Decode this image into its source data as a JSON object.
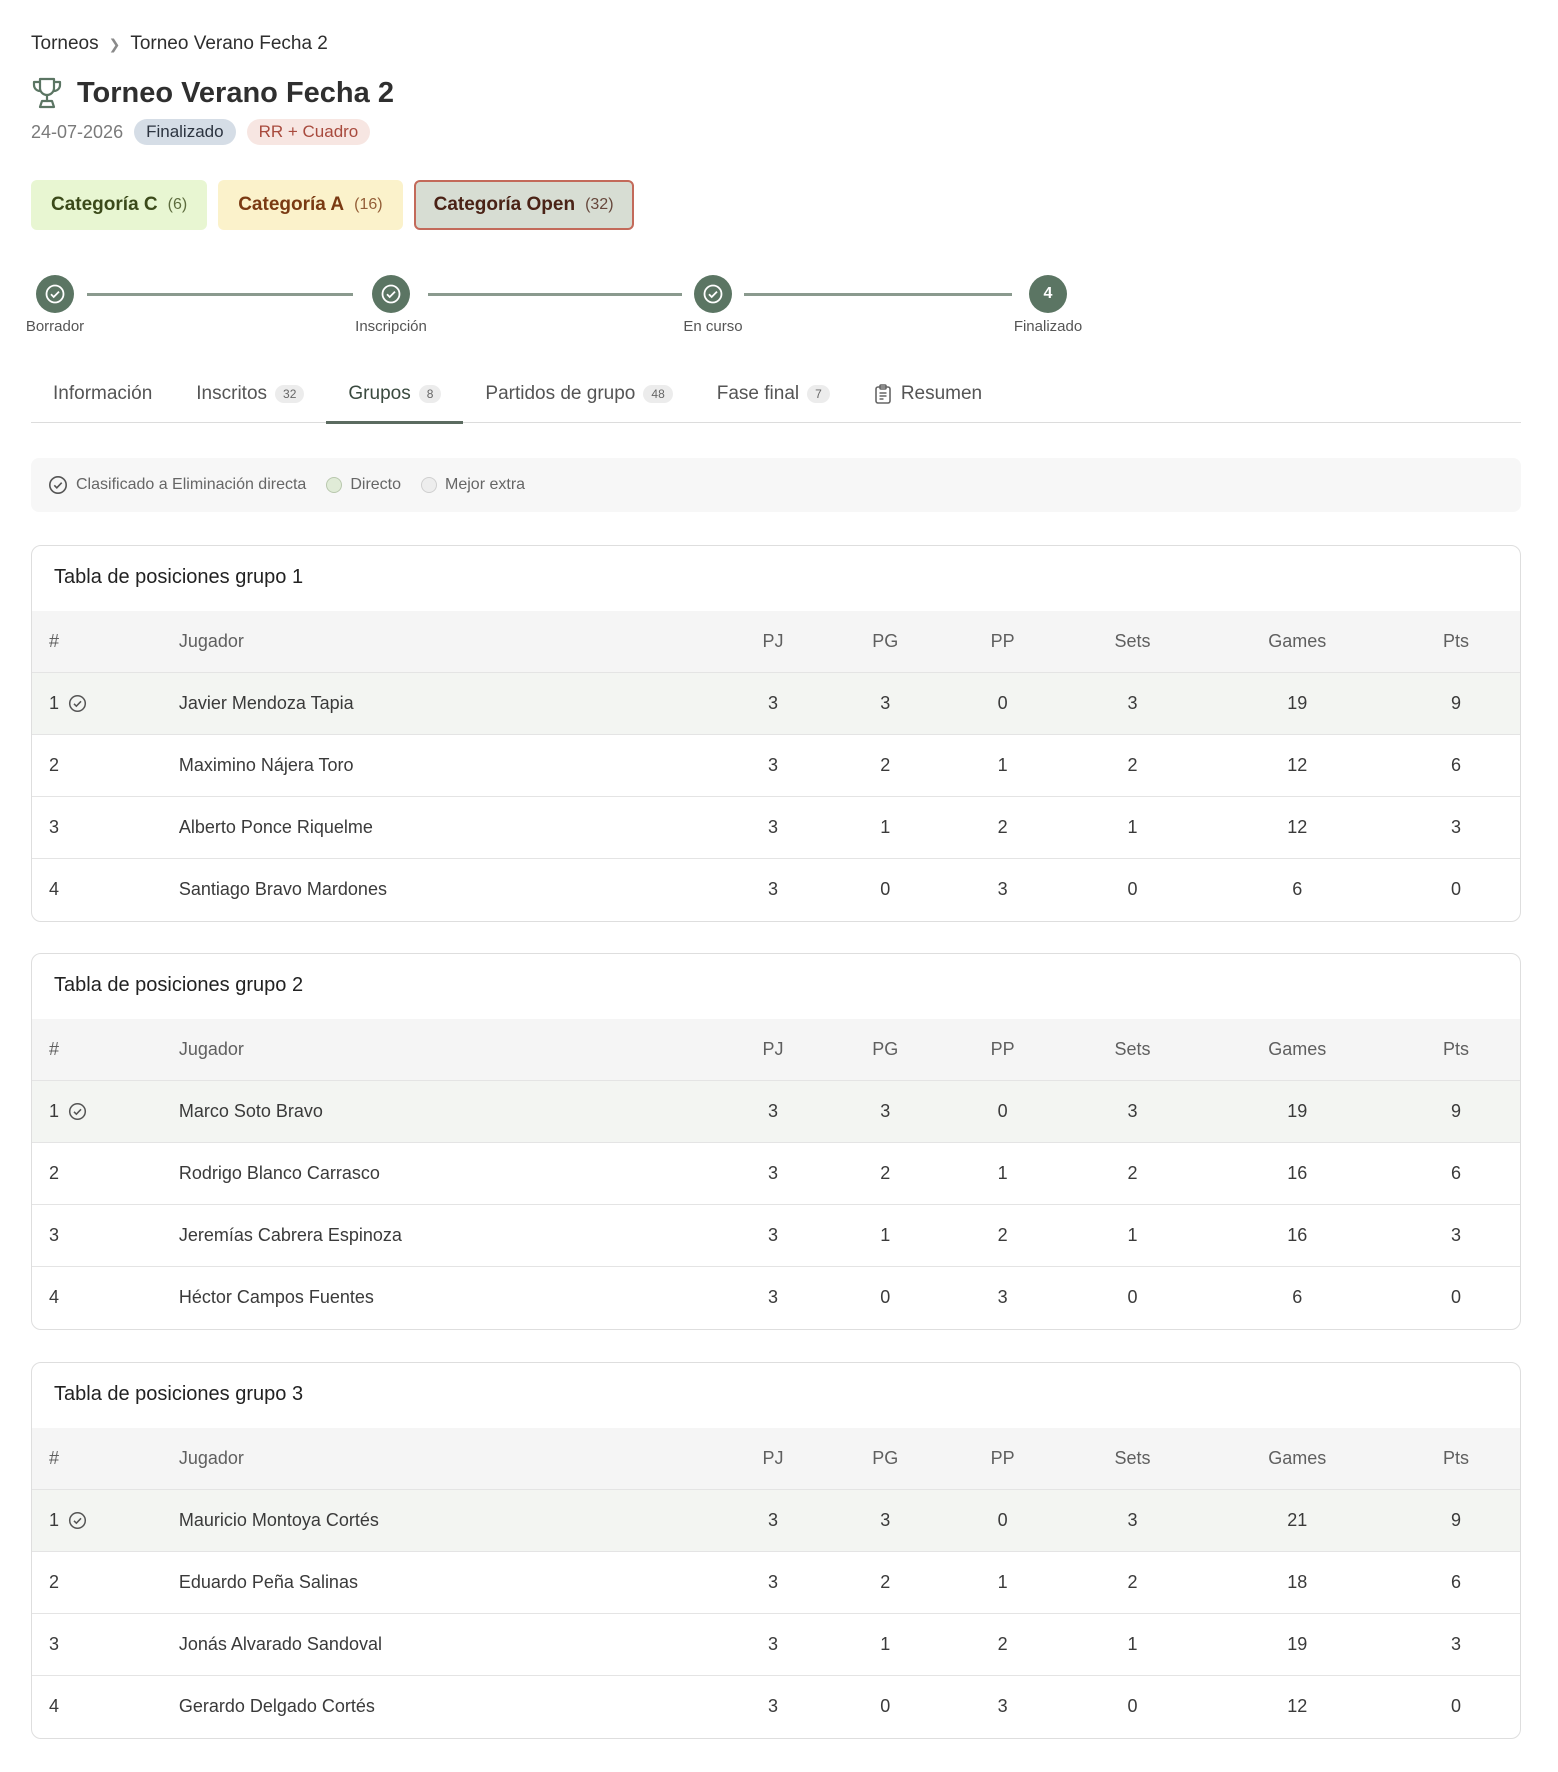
{
  "breadcrumb": {
    "parent": "Torneos",
    "current": "Torneo Verano Fecha 2"
  },
  "tournament": {
    "title": "Torneo Verano Fecha 2",
    "date": "24-07-2026",
    "status": "Finalizado",
    "format": "RR + Cuadro"
  },
  "categories": [
    {
      "label": "Categoría C",
      "count": "(6)"
    },
    {
      "label": "Categoría A",
      "count": "(16)"
    },
    {
      "label": "Categoría Open",
      "count": "(32)"
    }
  ],
  "stepper": [
    {
      "label": "Borrador",
      "marker": "check"
    },
    {
      "label": "Inscripción",
      "marker": "check"
    },
    {
      "label": "En curso",
      "marker": "check"
    },
    {
      "label": "Finalizado",
      "marker": "4"
    }
  ],
  "tabs": [
    {
      "label": "Información",
      "count": ""
    },
    {
      "label": "Inscritos",
      "count": "32"
    },
    {
      "label": "Grupos",
      "count": "8"
    },
    {
      "label": "Partidos de grupo",
      "count": "48"
    },
    {
      "label": "Fase final",
      "count": "7"
    },
    {
      "label": "Resumen",
      "count": ""
    }
  ],
  "legend": {
    "qualified": "Clasificado a Eliminación directa",
    "direct": "Directo",
    "best_extra": "Mejor extra"
  },
  "table_headers": {
    "pos": "#",
    "player": "Jugador",
    "pj": "PJ",
    "pg": "PG",
    "pp": "PP",
    "sets": "Sets",
    "games": "Games",
    "pts": "Pts"
  },
  "groups": [
    {
      "title": "Tabla de posiciones grupo 1",
      "rows": [
        {
          "pos": "1",
          "qualified": true,
          "player": "Javier Mendoza Tapia",
          "pj": "3",
          "pg": "3",
          "pp": "0",
          "sets": "3",
          "games": "19",
          "pts": "9"
        },
        {
          "pos": "2",
          "qualified": false,
          "player": "Maximino Nájera Toro",
          "pj": "3",
          "pg": "2",
          "pp": "1",
          "sets": "2",
          "games": "12",
          "pts": "6"
        },
        {
          "pos": "3",
          "qualified": false,
          "player": "Alberto Ponce Riquelme",
          "pj": "3",
          "pg": "1",
          "pp": "2",
          "sets": "1",
          "games": "12",
          "pts": "3"
        },
        {
          "pos": "4",
          "qualified": false,
          "player": "Santiago Bravo Mardones",
          "pj": "3",
          "pg": "0",
          "pp": "3",
          "sets": "0",
          "games": "6",
          "pts": "0"
        }
      ]
    },
    {
      "title": "Tabla de posiciones grupo 2",
      "rows": [
        {
          "pos": "1",
          "qualified": true,
          "player": "Marco Soto Bravo",
          "pj": "3",
          "pg": "3",
          "pp": "0",
          "sets": "3",
          "games": "19",
          "pts": "9"
        },
        {
          "pos": "2",
          "qualified": false,
          "player": "Rodrigo Blanco Carrasco",
          "pj": "3",
          "pg": "2",
          "pp": "1",
          "sets": "2",
          "games": "16",
          "pts": "6"
        },
        {
          "pos": "3",
          "qualified": false,
          "player": "Jeremías Cabrera Espinoza",
          "pj": "3",
          "pg": "1",
          "pp": "2",
          "sets": "1",
          "games": "16",
          "pts": "3"
        },
        {
          "pos": "4",
          "qualified": false,
          "player": "Héctor Campos Fuentes",
          "pj": "3",
          "pg": "0",
          "pp": "3",
          "sets": "0",
          "games": "6",
          "pts": "0"
        }
      ]
    },
    {
      "title": "Tabla de posiciones grupo 3",
      "rows": [
        {
          "pos": "1",
          "qualified": true,
          "player": "Mauricio Montoya Cortés",
          "pj": "3",
          "pg": "3",
          "pp": "0",
          "sets": "3",
          "games": "21",
          "pts": "9"
        },
        {
          "pos": "2",
          "qualified": false,
          "player": "Eduardo Peña Salinas",
          "pj": "3",
          "pg": "2",
          "pp": "1",
          "sets": "2",
          "games": "18",
          "pts": "6"
        },
        {
          "pos": "3",
          "qualified": false,
          "player": "Jonás Alvarado Sandoval",
          "pj": "3",
          "pg": "1",
          "pp": "2",
          "sets": "1",
          "games": "19",
          "pts": "3"
        },
        {
          "pos": "4",
          "qualified": false,
          "player": "Gerardo Delgado Cortés",
          "pj": "3",
          "pg": "0",
          "pp": "3",
          "sets": "0",
          "games": "12",
          "pts": "0"
        }
      ]
    }
  ]
}
